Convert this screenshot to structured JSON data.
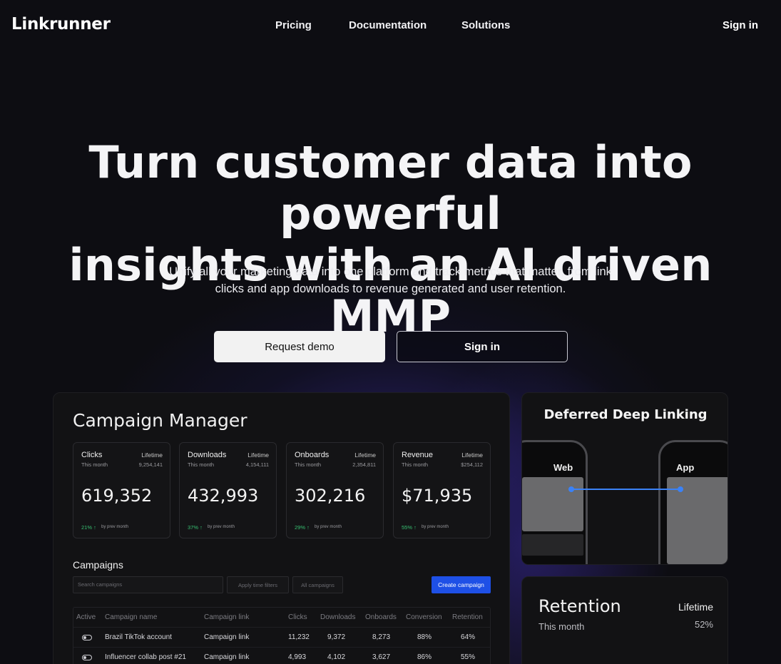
{
  "nav": {
    "logo": "Linkrunner",
    "links": [
      "Pricing",
      "Documentation",
      "Solutions"
    ],
    "sign_in": "Sign in"
  },
  "hero": {
    "title_line1": "Turn customer data into powerful",
    "title_line2": "insights with an AI driven MMP",
    "subtitle_line1": "Unify all your marketing data into one platform and track metrics that matter, from link",
    "subtitle_line2": "clicks and app downloads to revenue generated and user retention.",
    "request_demo": "Request demo",
    "sign_in": "Sign in"
  },
  "campaign_manager": {
    "title": "Campaign Manager",
    "stats": [
      {
        "name": "Clicks",
        "lifetime_label": "Lifetime",
        "month_label": "This month",
        "lifetime_value": "9,254,141",
        "value": "619,352",
        "change": "21% ↑",
        "prev": "by prev month"
      },
      {
        "name": "Downloads",
        "lifetime_label": "Lifetime",
        "month_label": "This month",
        "lifetime_value": "4,154,111",
        "value": "432,993",
        "change": "37% ↑",
        "prev": "by prev month"
      },
      {
        "name": "Onboards",
        "lifetime_label": "Lifetime",
        "month_label": "This month",
        "lifetime_value": "2,354,811",
        "value": "302,216",
        "change": "29% ↑",
        "prev": "by prev month"
      },
      {
        "name": "Revenue",
        "lifetime_label": "Lifetime",
        "month_label": "This month",
        "lifetime_value": "$254,112",
        "value": "$71,935",
        "change": "55% ↑",
        "prev": "by prev month"
      }
    ],
    "campaigns_heading": "Campaigns",
    "search_placeholder": "Search campaigns",
    "filter_time": "Apply time filters",
    "filter_all": "All campaigns",
    "create": "Create campaign",
    "columns": [
      "Active",
      "Campaign name",
      "Campaign link",
      "Clicks",
      "Downloads",
      "Onboards",
      "Conversion",
      "Retention"
    ],
    "rows": [
      {
        "name": "Brazil TikTok account",
        "link": "Campaign link",
        "clicks": "11,232",
        "downloads": "9,372",
        "onboards": "8,273",
        "conversion": "88%",
        "retention": "64%"
      },
      {
        "name": "Influencer collab post #21",
        "link": "Campaign link",
        "clicks": "4,993",
        "downloads": "4,102",
        "onboards": "3,627",
        "conversion": "86%",
        "retention": "55%"
      }
    ]
  },
  "deep_linking": {
    "title": "Deferred Deep Linking",
    "web_label": "Web",
    "app_label": "App",
    "accent": "#3b82f6"
  },
  "retention": {
    "title": "Retention",
    "month_label": "This month",
    "lifetime_label": "Lifetime",
    "value": "52%"
  }
}
